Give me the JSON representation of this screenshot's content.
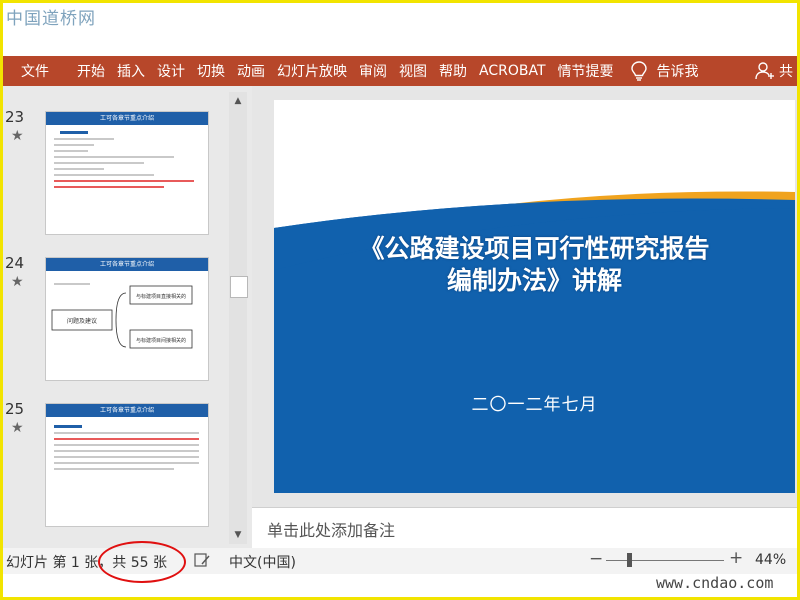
{
  "watermark_top": "中国道桥网",
  "ribbon": {
    "tabs": [
      "文件",
      "开始",
      "插入",
      "设计",
      "切换",
      "动画",
      "幻灯片放映",
      "审阅",
      "视图",
      "帮助",
      "ACROBAT",
      "情节提要"
    ],
    "tell_me": "告诉我",
    "share": "共"
  },
  "thumbnails": [
    {
      "number": "23",
      "title": "工可各章节重点介绍"
    },
    {
      "number": "24",
      "title": "工可各章节重点介绍",
      "center_box": "问题及建议",
      "right_top": "与标建项目直接相关的",
      "right_bottom": "与标建项目间接相关的"
    },
    {
      "number": "25",
      "title": "工可各章节重点介绍"
    }
  ],
  "slide": {
    "title_line1": "《公路建设项目可行性研究报告",
    "title_line2": "编制办法》讲解",
    "date": "二〇一二年七月"
  },
  "notes_placeholder": "单击此处添加备注",
  "status": {
    "slide_info": "幻灯片 第 1 张，共 55 张",
    "language": "中文(中国)",
    "zoom_percent": "44%"
  },
  "watermark_bottom": "www.cndao.com",
  "colors": {
    "ribbon": "#b7472a",
    "slide_blue": "#1161ad",
    "stripe_orange": "#f0a31e",
    "stripe_green": "#8cc13b",
    "annotation_circle": "#e01010"
  }
}
